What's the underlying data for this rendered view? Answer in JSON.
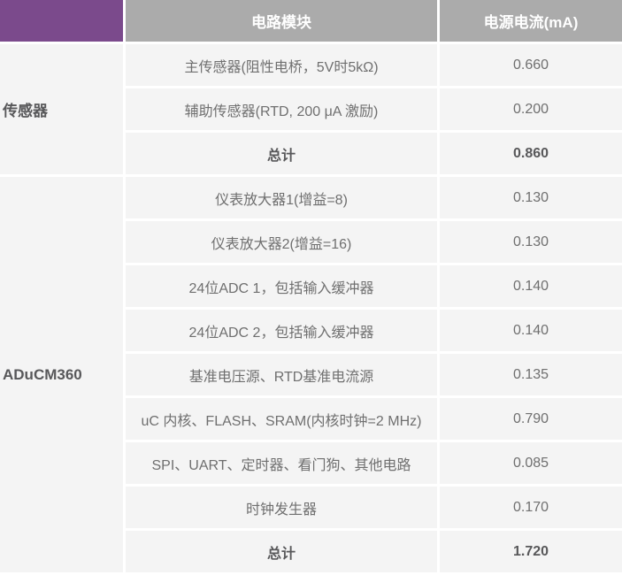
{
  "colors": {
    "accent_purple": "#7B4A8C",
    "header_gray": "#ABABAB",
    "row_background": "#F4F4F4",
    "body_text": "#6F6F6F",
    "bold_text": "#58585A",
    "header_text": "#FFFFFF"
  },
  "table": {
    "header": {
      "module": "电路模块",
      "current": "电源电流(mA)"
    },
    "groups": [
      {
        "label": "传感器",
        "rows": [
          {
            "module": "主传感器(阻性电桥，5V时5kΩ)",
            "current": "0.660"
          },
          {
            "module": "辅助传感器(RTD, 200 μA 激励)",
            "current": "0.200"
          },
          {
            "module": "总计",
            "current": "0.860"
          }
        ]
      },
      {
        "label": "ADuCM360",
        "rows": [
          {
            "module": "仪表放大器1(增益=8)",
            "current": "0.130"
          },
          {
            "module": "仪表放大器2(增益=16)",
            "current": "0.130"
          },
          {
            "module": "24位ADC 1，包括输入缓冲器",
            "current": "0.140"
          },
          {
            "module": "24位ADC 2，包括输入缓冲器",
            "current": "0.140"
          },
          {
            "module": "基准电压源、RTD基准电流源",
            "current": "0.135"
          },
          {
            "module": "uC 内核、FLASH、SRAM(内核时钟=2 MHz)",
            "current": "0.790"
          },
          {
            "module": "SPI、UART、定时器、看门狗、其他电路",
            "current": "0.085"
          },
          {
            "module": "时钟发生器",
            "current": "0.170"
          },
          {
            "module": "总计",
            "current": "1.720"
          }
        ]
      }
    ]
  }
}
